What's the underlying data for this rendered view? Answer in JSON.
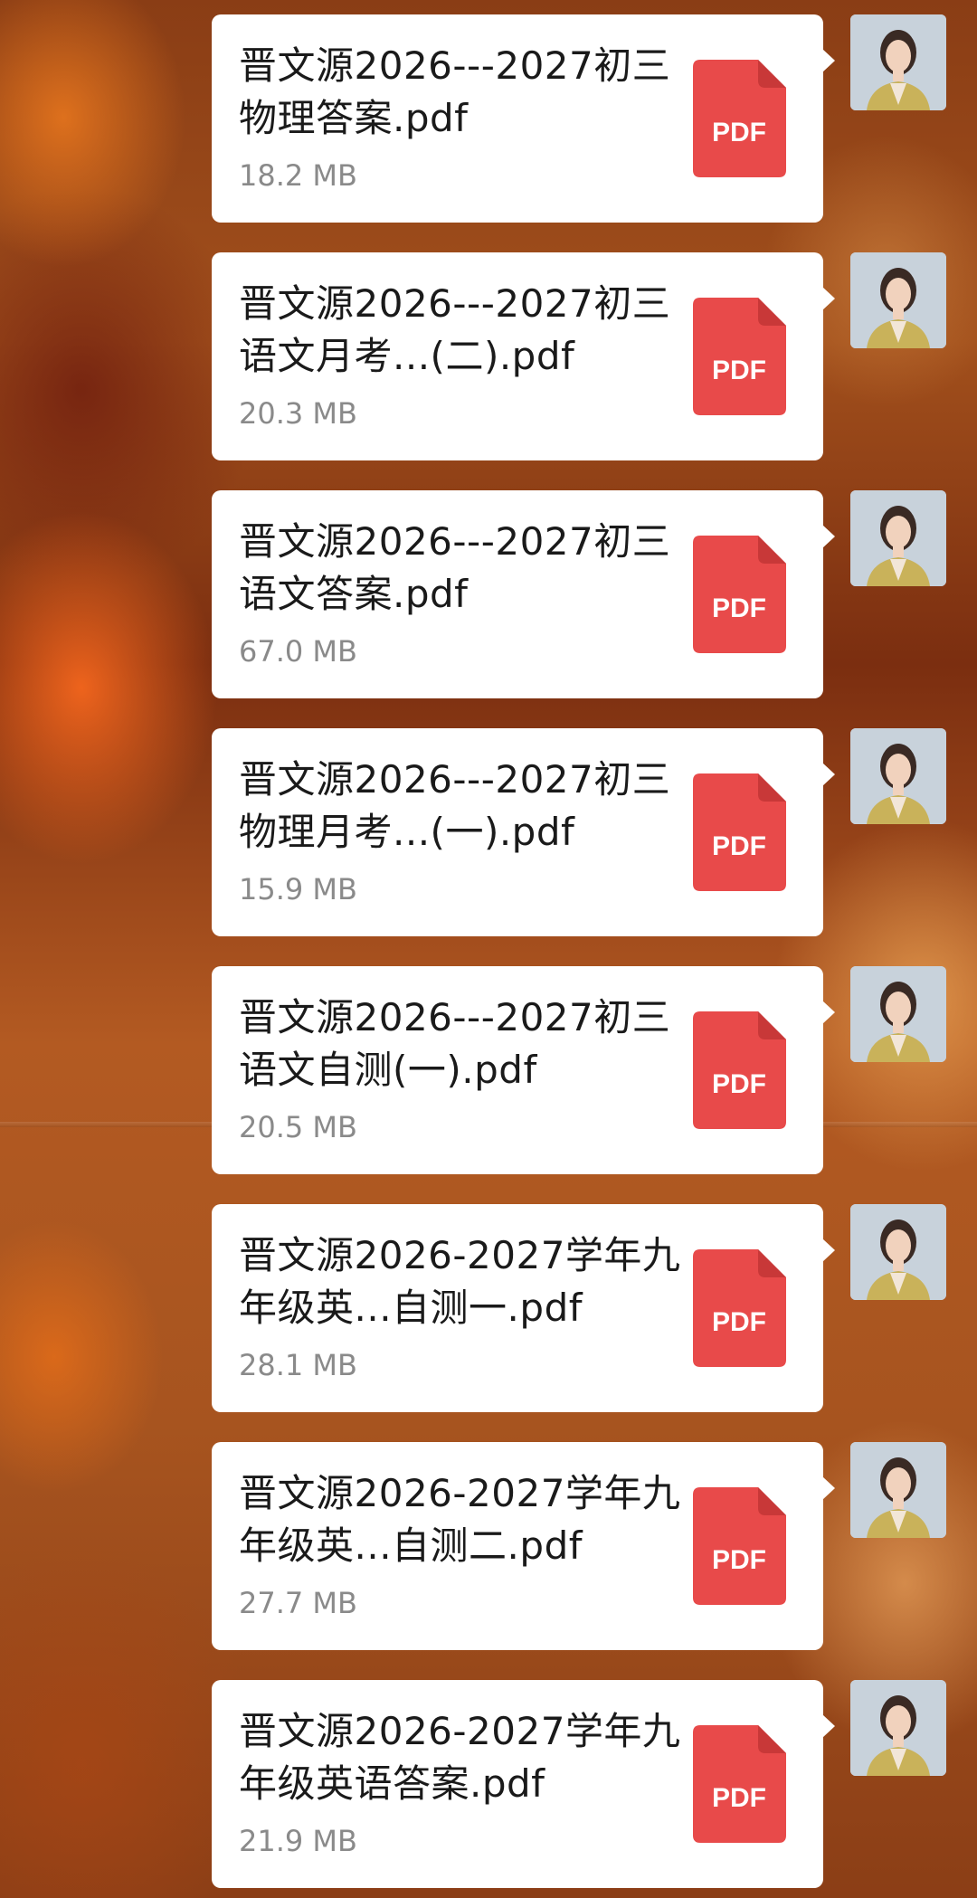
{
  "messages": [
    {
      "file_name": "晋文源2026---2027初三物理答案.pdf",
      "file_size": "18.2 MB",
      "icon_label": "PDF"
    },
    {
      "file_name": "晋文源2026---2027初三语文月考...(二).pdf",
      "file_size": "20.3 MB",
      "icon_label": "PDF"
    },
    {
      "file_name": "晋文源2026---2027初三语文答案.pdf",
      "file_size": "67.0 MB",
      "icon_label": "PDF"
    },
    {
      "file_name": "晋文源2026---2027初三物理月考...(一).pdf",
      "file_size": "15.9 MB",
      "icon_label": "PDF"
    },
    {
      "file_name": "晋文源2026---2027初三语文自测(一).pdf",
      "file_size": "20.5 MB",
      "icon_label": "PDF"
    },
    {
      "file_name": "晋文源2026-2027学年九年级英...自测一.pdf",
      "file_size": "28.1 MB",
      "icon_label": "PDF"
    },
    {
      "file_name": "晋文源2026-2027学年九年级英...自测二.pdf",
      "file_size": "27.7 MB",
      "icon_label": "PDF"
    },
    {
      "file_name": "晋文源2026-2027学年九年级英语答案.pdf",
      "file_size": "21.9 MB",
      "icon_label": "PDF"
    }
  ],
  "icons": {
    "file_icon": "pdf-file-icon",
    "avatar": "user-avatar"
  },
  "colors": {
    "bubble_bg": "#ffffff",
    "pdf_red": "#e84a4a",
    "pdf_fold": "#c83838",
    "file_size_gray": "#8a8a8a",
    "file_name_text": "#1a1a1a"
  }
}
